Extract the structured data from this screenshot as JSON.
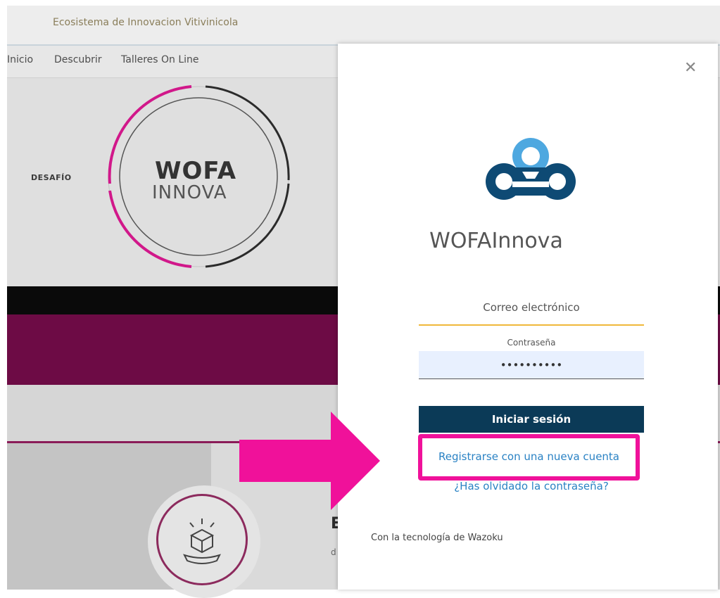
{
  "site": {
    "title": "Ecosistema de Innovacion Vitivinicola",
    "nav": [
      "Inicio",
      "Descubrir",
      "Talleres On Line"
    ]
  },
  "hero": {
    "challenge_label": "DESAFÍO",
    "logo_line1": "WOFA",
    "logo_line2": "INNOVA",
    "side_letter": "E",
    "side_small": "d"
  },
  "modal": {
    "close_label": "✕",
    "brand": "WOFAInnova",
    "email_label": "Correo electrónico",
    "password_label": "Contraseña",
    "password_value": "••••••••••",
    "login_button": "Iniciar sesión",
    "register_link": "Registrarse con una nueva cuenta",
    "forgot_link": "¿Has olvidado la contraseña?",
    "powered_by": "Con la tecnología de Wazoku"
  },
  "colors": {
    "accent_magenta": "#f0119a",
    "button_navy": "#0b3a57",
    "link_blue": "#2a82c4",
    "email_underline": "#f0b83a",
    "logo_light_blue": "#4ea8e0",
    "logo_dark_blue": "#0e4a74"
  }
}
